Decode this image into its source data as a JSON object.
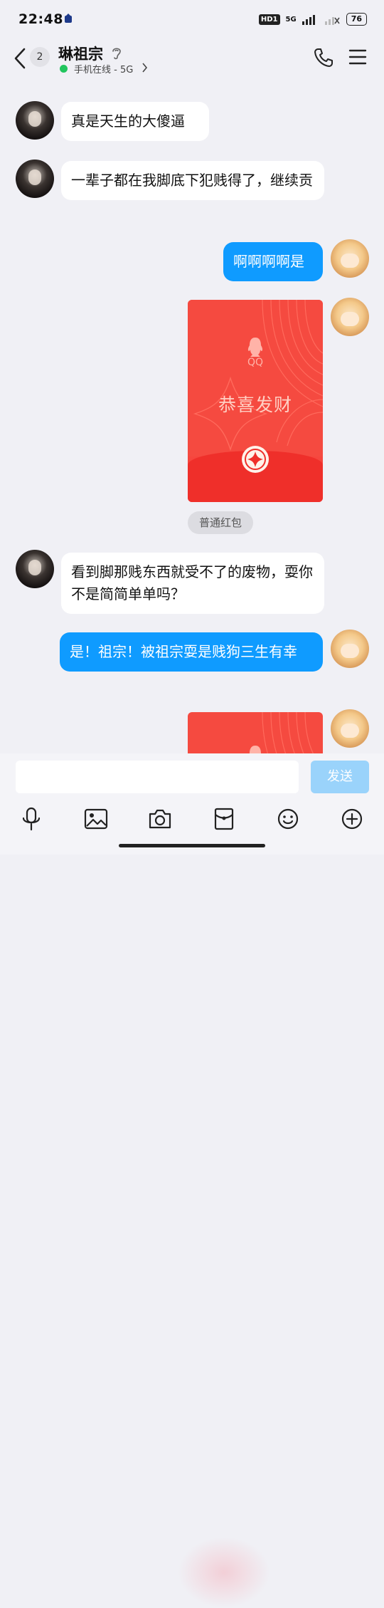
{
  "status_bar": {
    "time": "22:48",
    "hd_label": "HD1",
    "network": "5G",
    "battery": "76"
  },
  "header": {
    "unread_count": "2",
    "contact_name": "琳祖宗",
    "online_status": "手机在线 - 5G",
    "icons": [
      "back-icon",
      "ear-icon",
      "phone-icon",
      "menu-icon"
    ]
  },
  "messages": [
    {
      "side": "in",
      "text": "真是天生的大傻逼"
    },
    {
      "side": "in",
      "text": "一辈子都在我脚底下犯贱得了，继续贡"
    },
    {
      "side": "out",
      "text": "啊啊啊啊是"
    },
    {
      "side": "out",
      "type": "red_packet",
      "brand": "QQ",
      "title": "恭喜发财",
      "label": "普通红包"
    },
    {
      "side": "in",
      "text": "看到脚那贱东西就受不了的废物，耍你不是简简单单吗？"
    },
    {
      "side": "out",
      "text": "是！祖宗！被祖宗耍是贱狗三生有幸"
    },
    {
      "side": "out",
      "type": "red_packet_partial"
    }
  ],
  "input_bar": {
    "placeholder": "",
    "send_label": "发送",
    "tools": [
      "microphone-icon",
      "image-icon",
      "camera-icon",
      "red-packet-icon",
      "emoji-icon",
      "plus-icon"
    ]
  },
  "colors": {
    "outgoing_bubble": "#0f9bff",
    "incoming_bubble": "#ffffff",
    "red_packet": "#f6463e",
    "online_dot": "#22c55e",
    "send_button": "#9ad3fb"
  }
}
